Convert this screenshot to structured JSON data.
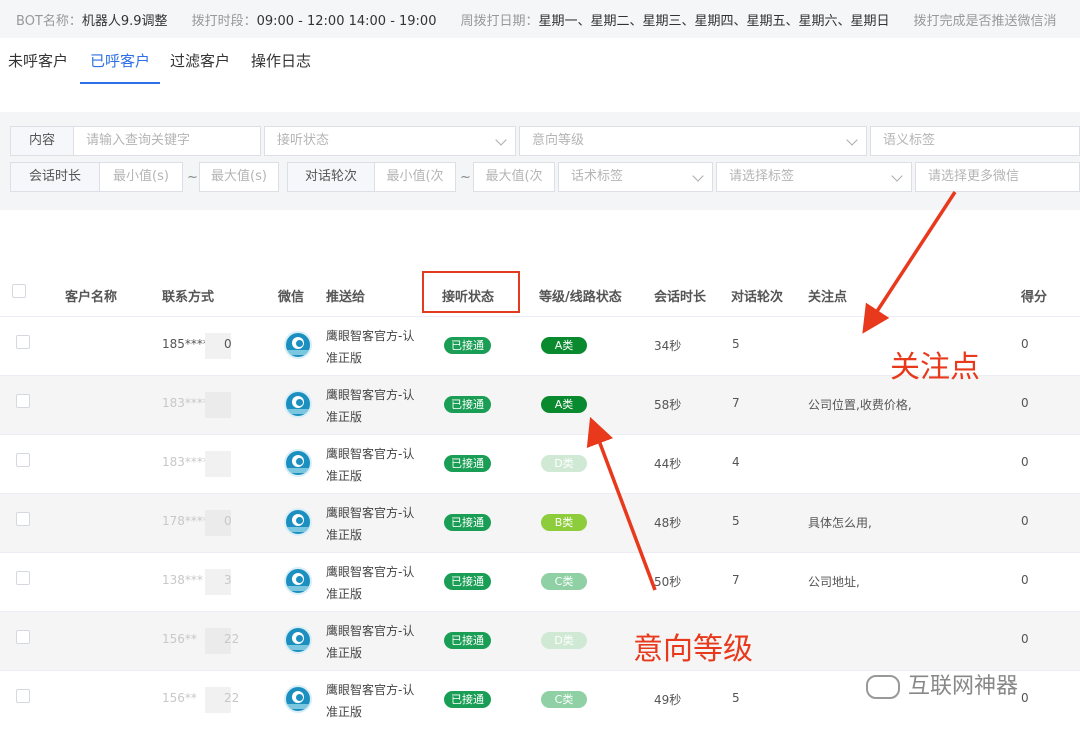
{
  "topbar": {
    "bot_label": "BOT名称：",
    "bot_value": "机器人9.9调整",
    "time_label": "拨打时段：",
    "time_value": "09:00 - 12:00 14:00 - 19:00",
    "weekday_label": "周拨打日期：",
    "weekday_value": "星期一、星期二、星期三、星期四、星期五、星期六、星期日",
    "push_label": "拨打完成是否推送微信消"
  },
  "tabs": [
    "未呼客户",
    "已呼客户",
    "过滤客户",
    "操作日志"
  ],
  "active_tab": "已呼客户",
  "filters": {
    "content_label": "内容",
    "content_placeholder": "请输入查询关键字",
    "answer_status": "接听状态",
    "intent_level": "意向等级",
    "semantic_tag": "语义标签",
    "duration_label": "会话时长",
    "min_s": "最小值(s)",
    "tilde": "~",
    "max_s": "最大值(s)",
    "turns_label": "对话轮次",
    "min_turn": "最小值(次",
    "max_turn": "最大值(次",
    "script_tag": "话术标签",
    "select_tag": "请选择标签",
    "more_wechat": "请选择更多微信"
  },
  "table": {
    "headers": {
      "name": "客户名称",
      "contact": "联系方式",
      "wechat": "微信",
      "push_to": "推送给",
      "answer_status": "接听状态",
      "level": "等级/线路状态",
      "duration": "会话时长",
      "turns": "对话轮次",
      "focus": "关注点",
      "score": "得分"
    },
    "rows": [
      {
        "phone": "185****",
        "phone_tail": "0",
        "push_line1": "鹰眼智客官方-认",
        "push_line2": "准正版",
        "status": "已接通",
        "level": "A类",
        "duration": "34秒",
        "turns": "5",
        "focus": "",
        "score": "0"
      },
      {
        "phone": "183****",
        "phone_tail": "",
        "push_line1": "鹰眼智客官方-认",
        "push_line2": "准正版",
        "status": "已接通",
        "level": "A类",
        "duration": "58秒",
        "turns": "7",
        "focus": "公司位置,收费价格,",
        "score": "0"
      },
      {
        "phone": "183****",
        "phone_tail": "",
        "push_line1": "鹰眼智客官方-认",
        "push_line2": "准正版",
        "status": "已接通",
        "level": "D类",
        "duration": "44秒",
        "turns": "4",
        "focus": "",
        "score": "0"
      },
      {
        "phone": "178****",
        "phone_tail": "0",
        "push_line1": "鹰眼智客官方-认",
        "push_line2": "准正版",
        "status": "已接通",
        "level": "B类",
        "duration": "48秒",
        "turns": "5",
        "focus": "具体怎么用,",
        "score": "0"
      },
      {
        "phone": "138***",
        "phone_tail": "3",
        "push_line1": "鹰眼智客官方-认",
        "push_line2": "准正版",
        "status": "已接通",
        "level": "C类",
        "duration": "50秒",
        "turns": "7",
        "focus": "公司地址,",
        "score": "0"
      },
      {
        "phone": "156**",
        "phone_tail": "22",
        "push_line1": "鹰眼智客官方-认",
        "push_line2": "准正版",
        "status": "已接通",
        "level": "D类",
        "duration": "",
        "turns": "",
        "focus": "",
        "score": "0"
      },
      {
        "phone": "156**",
        "phone_tail": "22",
        "push_line1": "鹰眼智客官方-认",
        "push_line2": "准正版",
        "status": "已接通",
        "level": "C类",
        "duration": "49秒",
        "turns": "5",
        "focus": "",
        "score": "0"
      }
    ]
  },
  "level_colors": {
    "A类": "#0a8a2f",
    "B类": "#8dcc3a",
    "C类": "#8fd0a4",
    "D类": "#cfe9d4"
  },
  "status_color": "#1a9e55",
  "annotations": {
    "focus_point": "关注点",
    "intent_level": "意向等级",
    "color": "#e9391d"
  },
  "watermark": "互联网神器"
}
